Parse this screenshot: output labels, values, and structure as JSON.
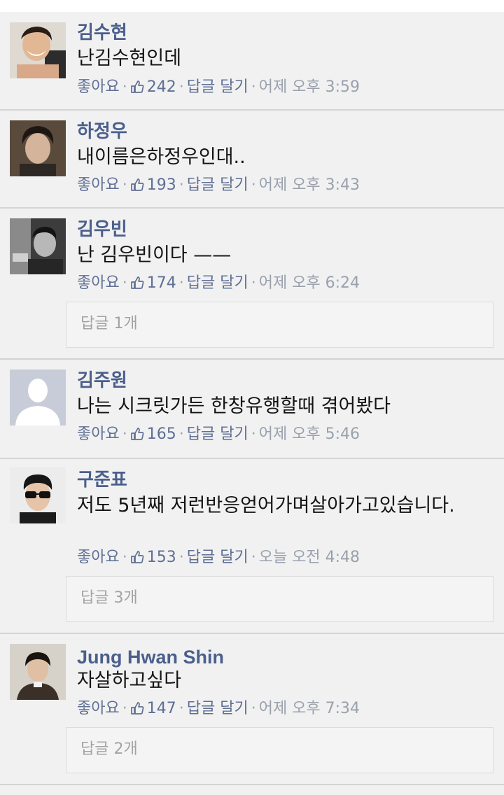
{
  "comments": [
    {
      "name": "김수현",
      "text": "난김수현인데",
      "like_label": "좋아요",
      "like_count": "242",
      "reply_label": "답글 달기",
      "time": "어제 오후 3:59"
    },
    {
      "name": "하정우",
      "text": "내이름은하정우인대..",
      "like_label": "좋아요",
      "like_count": "193",
      "reply_label": "답글 달기",
      "time": "어제 오후 3:43"
    },
    {
      "name": "김우빈",
      "text": "난 김우빈이다 ——",
      "like_label": "좋아요",
      "like_count": "174",
      "reply_label": "답글 달기",
      "time": "어제 오후 6:24",
      "replies": "답글 1개"
    },
    {
      "name": "김주원",
      "text": "나는 시크릿가든 한창유행할때 겪어봤다",
      "like_label": "좋아요",
      "like_count": "165",
      "reply_label": "답글 달기",
      "time": "어제 오후 5:46"
    },
    {
      "name": "구준표",
      "text": "저도 5년째 저런반응얻어가며살아가고있습니다.",
      "like_label": "좋아요",
      "like_count": "153",
      "reply_label": "답글 달기",
      "time": "오늘 오전 4:48",
      "replies": "답글 3개"
    },
    {
      "name": "Jung Hwan Shin",
      "text": "자살하고싶다",
      "like_label": "좋아요",
      "like_count": "147",
      "reply_label": "답글 달기",
      "time": "어제 오후 7:34",
      "replies": "답글 2개"
    }
  ],
  "colors": {
    "name": "#4b5f8c",
    "action": "#5f6f95",
    "muted": "#9aa1ad",
    "background": "#f1f1f1"
  },
  "icons": {
    "like": "thumbs-up-icon"
  }
}
